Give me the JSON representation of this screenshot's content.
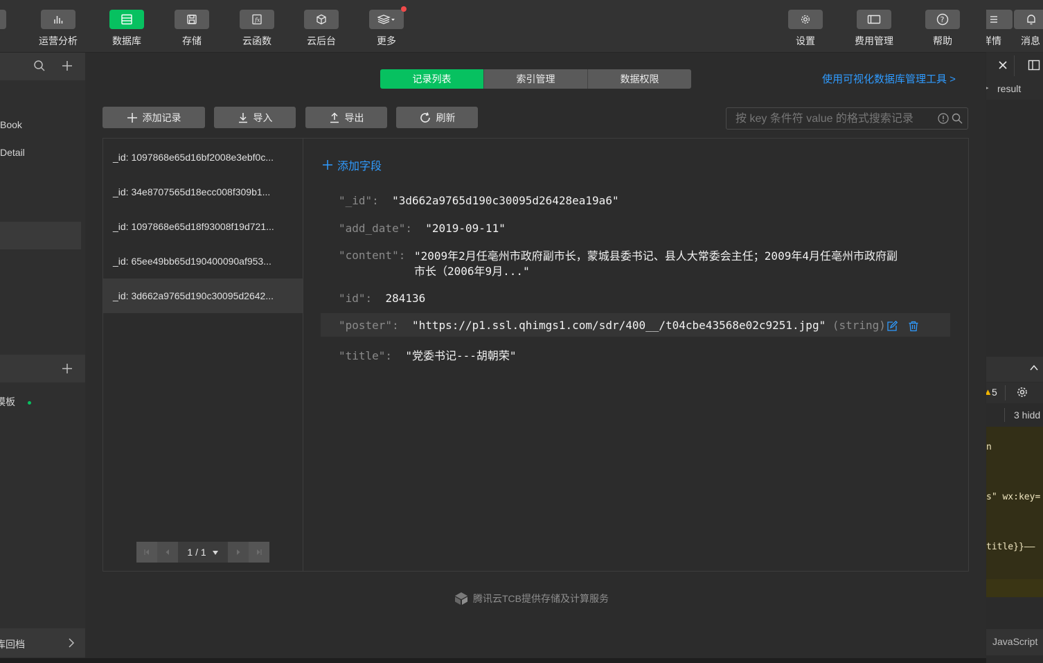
{
  "toolbar": {
    "items": [
      {
        "label": "运营分析",
        "icon": "bar-chart-icon"
      },
      {
        "label": "数据库",
        "icon": "database-icon",
        "active": true
      },
      {
        "label": "存储",
        "icon": "storage-icon"
      },
      {
        "label": "云函数",
        "icon": "function-icon"
      },
      {
        "label": "云后台",
        "icon": "cube-icon"
      },
      {
        "label": "更多",
        "icon": "layers-icon"
      }
    ],
    "right_items": [
      {
        "label": "设置",
        "icon": "gear-icon"
      },
      {
        "label": "费用管理",
        "icon": "card-icon"
      },
      {
        "label": "帮助",
        "icon": "help-icon"
      }
    ]
  },
  "sidebar": {
    "collections": [
      "Book",
      "Detail"
    ],
    "second_section_item": "模板",
    "bottom_item": "库回档"
  },
  "main": {
    "tabs": [
      "记录列表",
      "索引管理",
      "数据权限"
    ],
    "active_tab": "记录列表",
    "visual_tool_link": "使用可视化数据库管理工具 >",
    "actions": {
      "add_record": "添加记录",
      "import": "导入",
      "export": "导出",
      "refresh": "刷新"
    },
    "search": {
      "placeholder": "按 key 条件符 value 的格式搜索记录"
    },
    "records": [
      "_id: 1097868e65d16bf2008e3ebf0c...",
      "_id: 34e8707565d18ecc008f309b1...",
      "_id: 1097868e65d18f93008f19d721...",
      "_id: 65ee49bb65d190400090af953...",
      "_id: 3d662a9765d190c30095d2642..."
    ],
    "selected_record_index": 4,
    "pager": "1 / 1",
    "add_field": "添加字段",
    "fields": {
      "id_key": "\"_id\":",
      "id_val": "\"3d662a9765d190c30095d26428ea19a6\"",
      "add_date_key": "\"add_date\":",
      "add_date_val": "\"2019-09-11\"",
      "content_key": "\"content\":",
      "content_line1": "\"2009年2月任亳州市政府副市长，蒙城县委书记、县人大常委会主任；2009年4月任亳州市政府副",
      "content_line2": "市长（2006年9月...\"",
      "num_id_key": "\"id\":",
      "num_id_val": "284136",
      "poster_key": "\"poster\":",
      "poster_val": "\"https://p1.ssl.qhimgs1.com/sdr/400__/t04cbe43568e02c9251.jpg\"",
      "poster_type": "(string)",
      "title_key": "\"title\":",
      "title_val": "\"党委书记---胡朝荣\""
    },
    "footer": "腾讯云TCB提供存储及计算服务"
  },
  "right_panel": {
    "top_labels": [
      "详情",
      "消息"
    ],
    "tab_result": "result",
    "warning_count": "5",
    "hidden_text": "3 hidd",
    "code_lines": [
      "n",
      "s\" wx:key=",
      "title}}——"
    ],
    "language": "JavaScript"
  },
  "colors": {
    "accent": "#07c160",
    "link": "#2f9bff",
    "warning": "#f0b400"
  }
}
